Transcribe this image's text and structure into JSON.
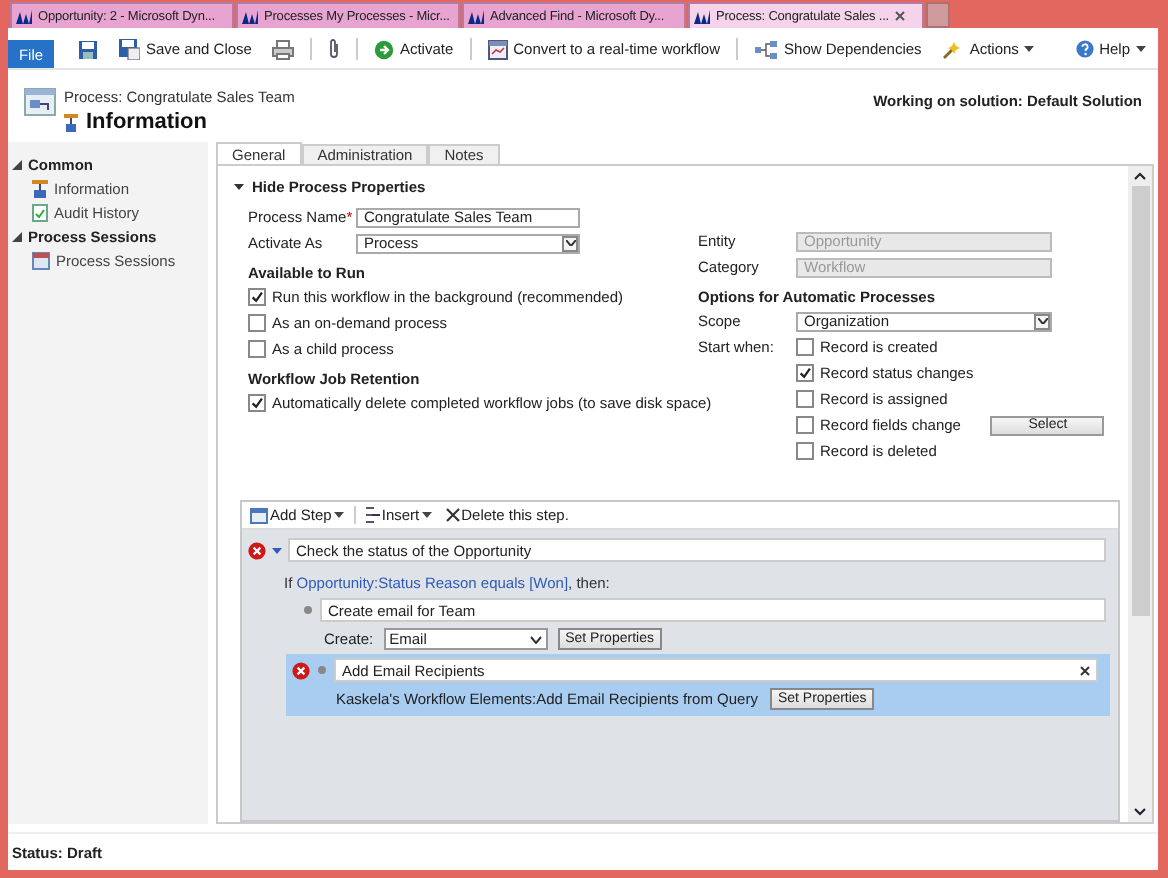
{
  "browser_tabs": [
    {
      "label": "Opportunity: 2 - Microsoft Dyn...",
      "selected": false
    },
    {
      "label": "Processes My Processes - Micr...",
      "selected": false
    },
    {
      "label": "Advanced Find - Microsoft Dy...",
      "selected": false
    },
    {
      "label": "Process: Congratulate Sales ...",
      "selected": true
    }
  ],
  "toolbar": {
    "file": "File",
    "items": [
      {
        "kind": "save"
      },
      {
        "kind": "save-close",
        "label": "Save and Close"
      },
      {
        "kind": "print"
      },
      {
        "kind": "separator"
      },
      {
        "kind": "attach"
      },
      {
        "kind": "separator"
      },
      {
        "kind": "activate",
        "label": "Activate"
      },
      {
        "kind": "separator"
      },
      {
        "kind": "convert",
        "label": "Convert to a real-time workflow"
      },
      {
        "kind": "separator"
      },
      {
        "kind": "dependencies",
        "label": "Show Dependencies"
      },
      {
        "kind": "actions",
        "label": "Actions"
      }
    ],
    "help": "Help"
  },
  "header": {
    "breadcrumb": "Process: Congratulate Sales Team",
    "title": "Information",
    "solution": "Working on solution: Default Solution"
  },
  "sidebar": [
    {
      "label": "Common",
      "expanded": true,
      "items": [
        {
          "label": "Information",
          "kind": "info"
        },
        {
          "label": "Audit History",
          "kind": "audit"
        }
      ]
    },
    {
      "label": "Process Sessions",
      "expanded": true,
      "items": [
        {
          "label": "Process Sessions",
          "kind": "sessions"
        }
      ]
    }
  ],
  "form_tabs": [
    {
      "label": "General",
      "selected": true
    },
    {
      "label": "Administration",
      "selected": false
    },
    {
      "label": "Notes",
      "selected": false
    }
  ],
  "section": {
    "label": "Hide Process Properties",
    "expanded": true
  },
  "left": {
    "process_name": {
      "label": "Process Name",
      "required_mark": "*",
      "value": "Congratulate Sales Team"
    },
    "activate_as": {
      "label": "Activate As",
      "value": "Process"
    },
    "available": {
      "heading": "Available to Run",
      "options": [
        {
          "label": "Run this workflow in the background (recommended)",
          "checked": true
        },
        {
          "label": "As an on-demand process",
          "checked": false
        },
        {
          "label": "As a child process",
          "checked": false
        }
      ]
    },
    "retention": {
      "heading": "Workflow Job Retention",
      "options": [
        {
          "label": "Automatically delete completed workflow jobs (to save disk space)",
          "checked": true
        }
      ]
    }
  },
  "right": {
    "entity": {
      "label": "Entity",
      "value": "Opportunity",
      "disabled": true
    },
    "category": {
      "label": "Category",
      "value": "Workflow",
      "disabled": true
    },
    "options_heading": "Options for Automatic Processes",
    "scope": {
      "label": "Scope",
      "value": "Organization"
    },
    "start_when": {
      "label": "Start when:",
      "options": [
        {
          "label": "Record is created",
          "checked": false
        },
        {
          "label": "Record status changes",
          "checked": true
        },
        {
          "label": "Record is assigned",
          "checked": false
        },
        {
          "label": "Record fields change",
          "checked": false,
          "button": "Select"
        },
        {
          "label": "Record is deleted",
          "checked": false
        }
      ]
    }
  },
  "designer": {
    "toolbar": [
      {
        "kind": "add",
        "label": "Add Step"
      },
      {
        "kind": "insert",
        "label": "Insert"
      },
      {
        "kind": "delete",
        "label": "Delete this step."
      }
    ],
    "stage": {
      "text": "Check the status of the Opportunity",
      "error": true,
      "condition": {
        "prefix": "If ",
        "link": "Opportunity:Status Reason equals [Won]",
        "suffix": ", then:"
      },
      "children": [
        {
          "kind": "create",
          "text": "Create email for Team",
          "error": false,
          "selected": false,
          "create_label": "Create:",
          "create_value": "Email",
          "button": "Set Properties"
        },
        {
          "kind": "custom",
          "text": "Add Email Recipients",
          "error": true,
          "selected": true,
          "description": "Kaskela's Workflow Elements:Add Email Recipients from Query",
          "button": "Set Properties"
        }
      ]
    }
  },
  "status": "Status: Draft"
}
